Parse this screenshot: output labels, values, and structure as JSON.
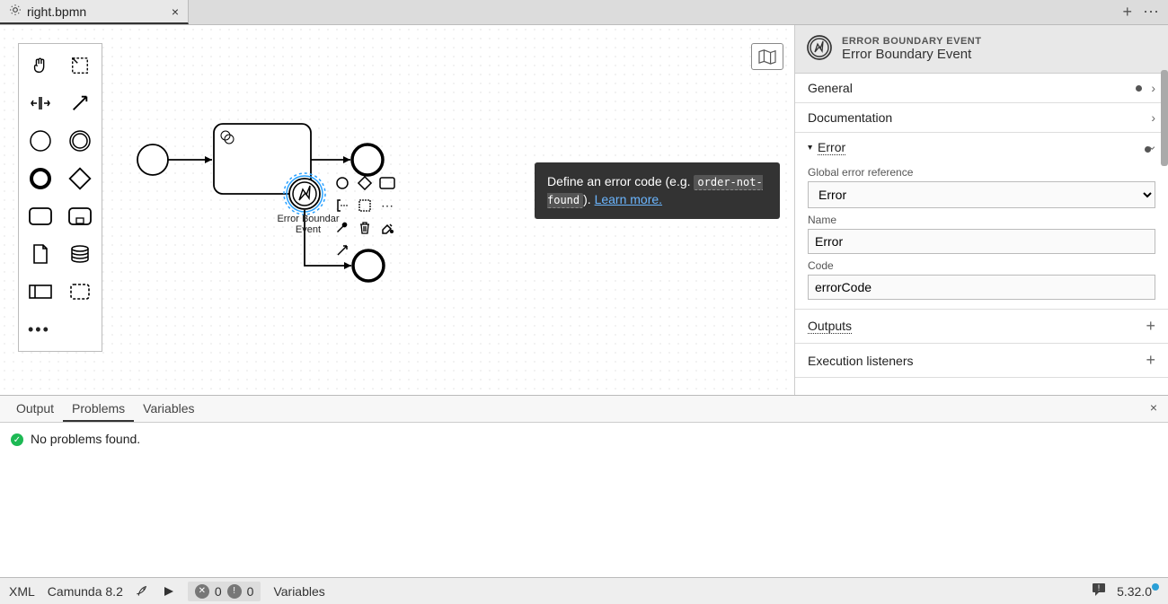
{
  "tab": {
    "filename": "right.bpmn"
  },
  "tooltip": {
    "pre": "Define an error code (e.g. ",
    "code": "order-not-found",
    "post": "). ",
    "link": "Learn more."
  },
  "node": {
    "label1": "Error Boundar",
    "label2": "Event"
  },
  "panel": {
    "typeUpper": "ERROR BOUNDARY EVENT",
    "typeName": "Error Boundary Event",
    "sections": {
      "general": "General",
      "documentation": "Documentation",
      "error": "Error",
      "outputs": "Outputs",
      "execution": "Execution listeners"
    },
    "fields": {
      "globalRefLabel": "Global error reference",
      "globalRefValue": "Error",
      "nameLabel": "Name",
      "nameValue": "Error",
      "codeLabel": "Code",
      "codeValue": "errorCode"
    }
  },
  "bottom": {
    "tabs": {
      "output": "Output",
      "problems": "Problems",
      "variables": "Variables"
    },
    "message": "No problems found."
  },
  "status": {
    "xml": "XML",
    "platform": "Camunda 8.2",
    "errCount": "0",
    "warnCount": "0",
    "variables": "Variables",
    "version": "5.32.0"
  }
}
